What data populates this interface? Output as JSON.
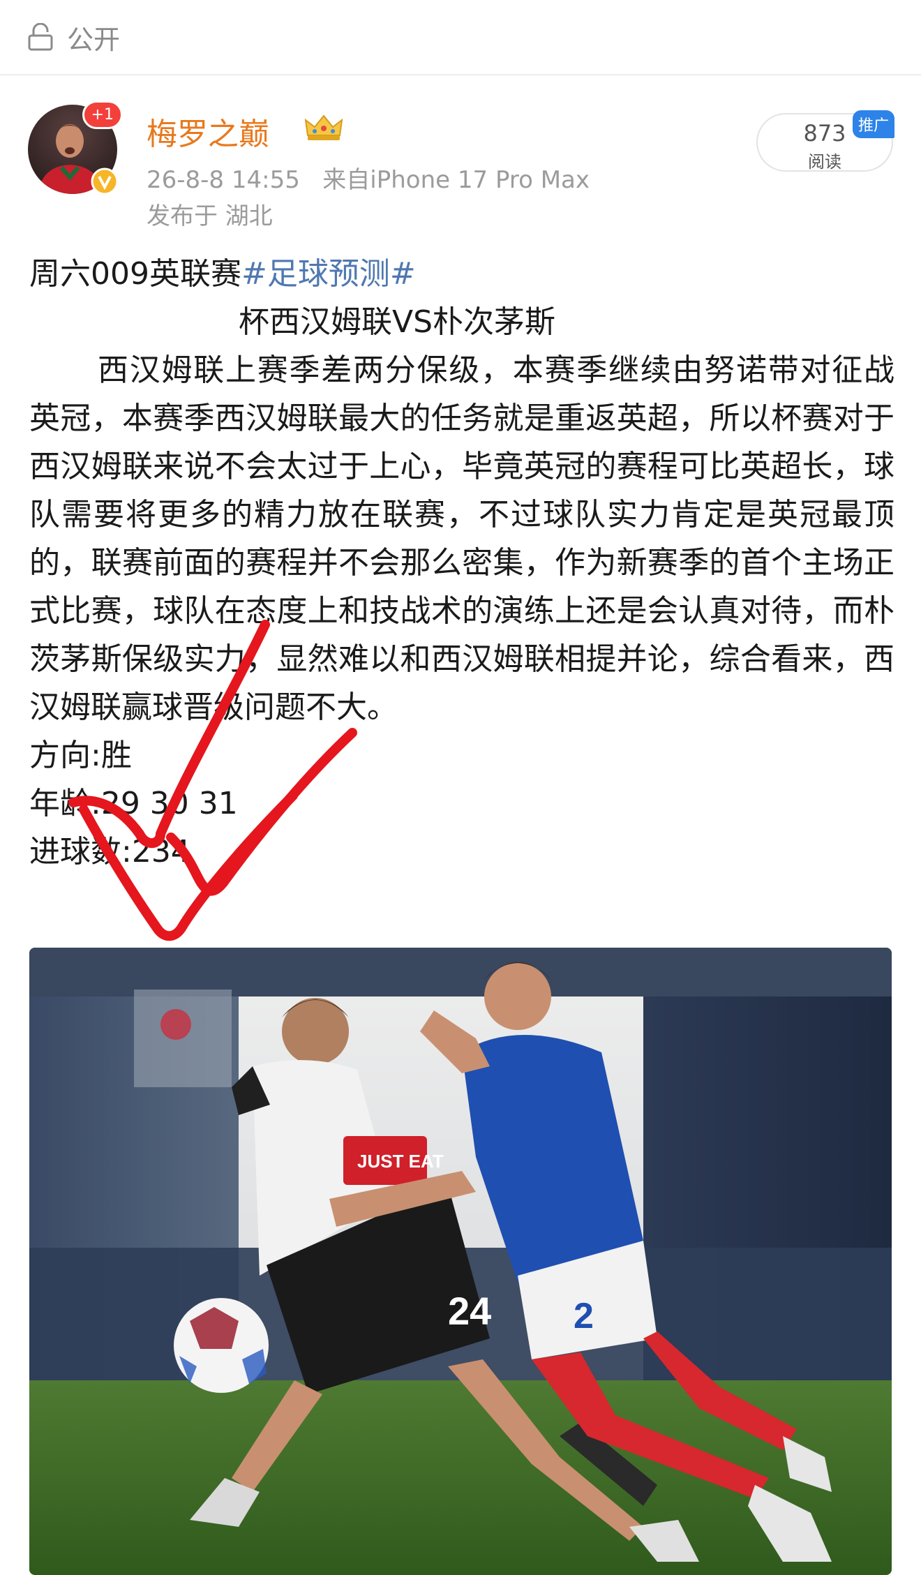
{
  "top_bar": {
    "visibility_label": "公开",
    "icon": "lock-icon"
  },
  "post": {
    "author": "梅罗之巅",
    "avatar_badge": "+1",
    "time": "26-8-8 14:55",
    "source": "来自iPhone 17 Pro Max",
    "location": "发布于 湖北",
    "reads_count": "873",
    "reads_label": "阅读",
    "promo_tag": "推广"
  },
  "content": {
    "title_prefix": "周六009英联赛",
    "hashtag": "#足球预测#",
    "subtitle": "杯西汉姆联VS朴次茅斯",
    "paragraph": "西汉姆联上赛季差两分保级，本赛季继续由努诺带对征战英冠，本赛季西汉姆联最大的任务就是重返英超，所以杯赛对于西汉姆联来说不会太过于上心，毕竟英冠的赛程可比英超长，球队需要将更多的精力放在联赛，不过球队实力肯定是英冠最顶的，联赛前面的赛程并不会那么密集，作为新赛季的首个主场正式比赛，球队在态度上和技战术的演练上还是会认真对待，而朴茨茅斯保级实力，显然难以和西汉姆联相提并论，综合看来，西汉姆联赢球晋级问题不大。",
    "direction": "方向:胜",
    "age": "年龄:29 30 31",
    "goals": "进球数:234"
  },
  "photo": {
    "sponsor_text": "JUST EAT",
    "number_left": "24",
    "number_right": "2"
  },
  "colors": {
    "author": "#e8791d",
    "hashtag": "#4f78b0",
    "meta": "#9b9b9b",
    "promo": "#2d83e8",
    "check_mark": "#e5161d"
  }
}
